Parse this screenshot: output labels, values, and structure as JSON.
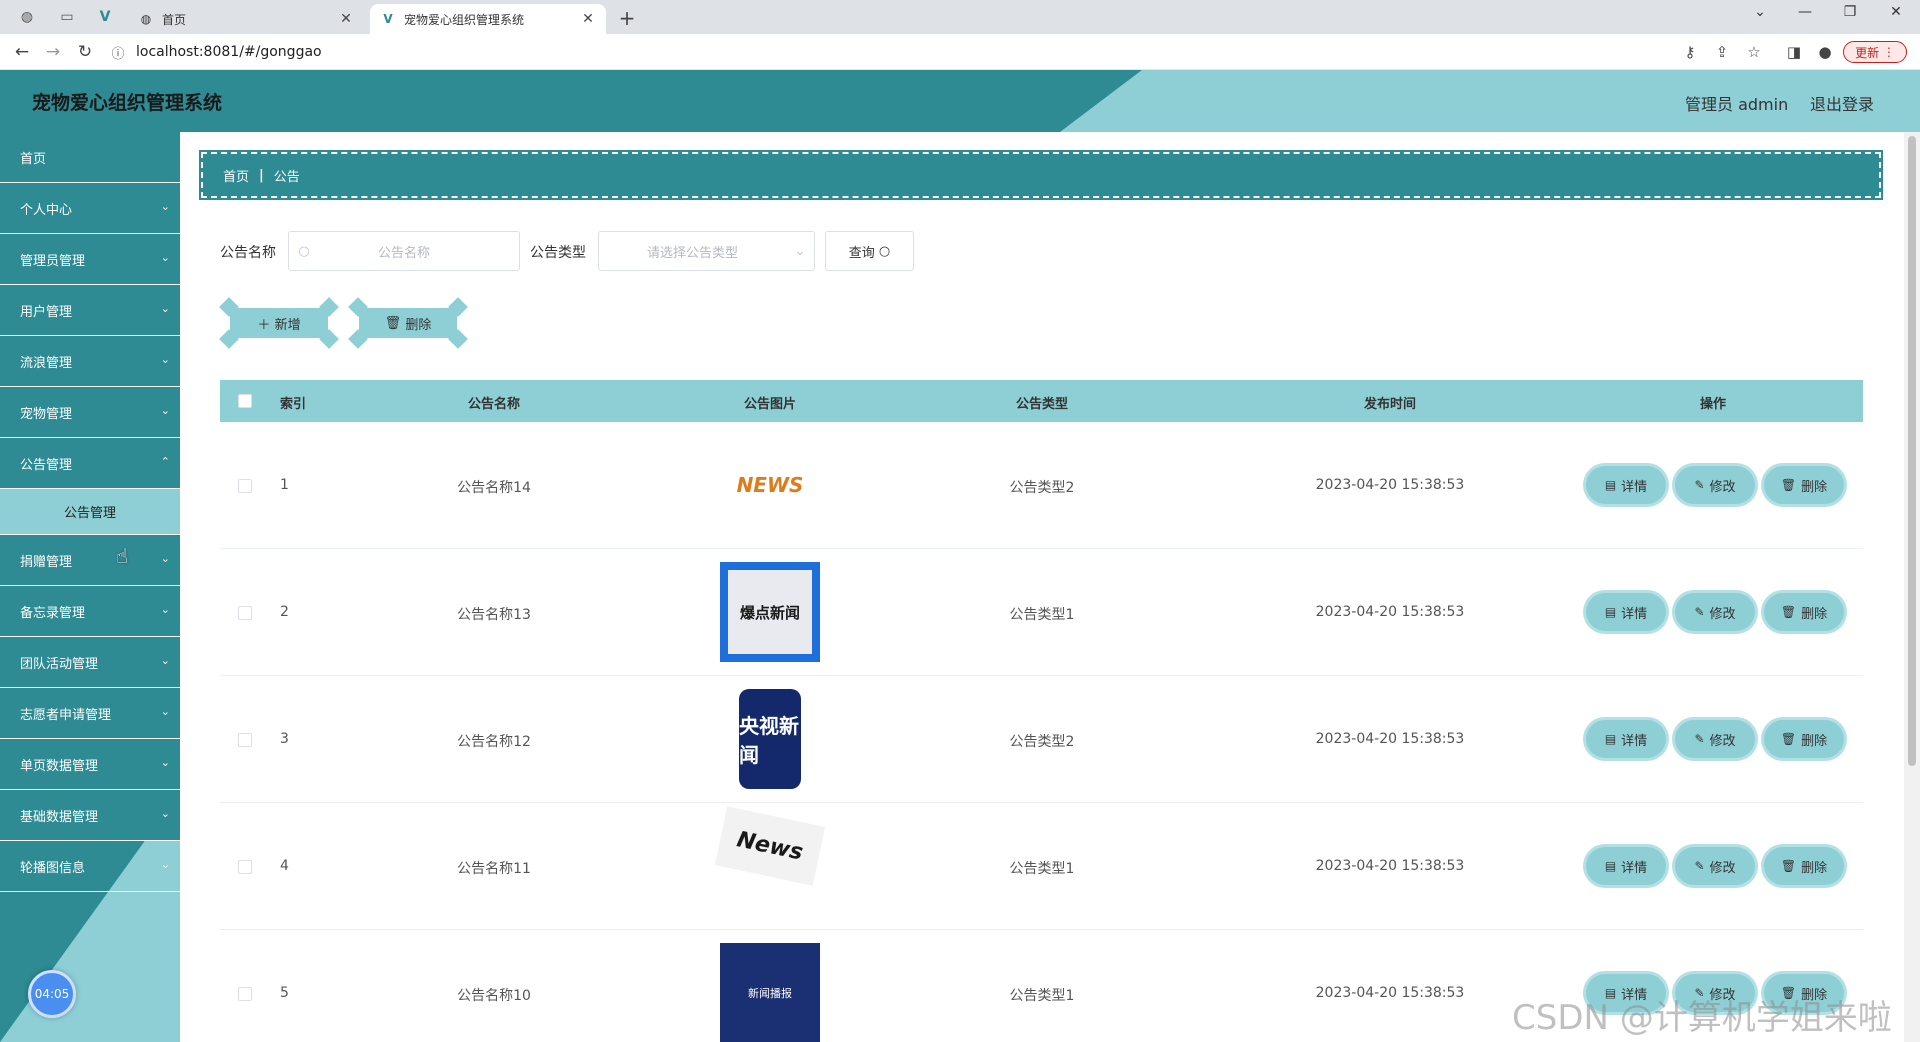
{
  "browser": {
    "tabs": [
      {
        "title": "首页",
        "active": false
      },
      {
        "title": "宠物爱心组织管理系统",
        "active": true
      }
    ],
    "new_tab": "+",
    "url": "localhost:8081/#/gonggao",
    "update_label": "更新"
  },
  "header": {
    "title": "宠物爱心组织管理系统",
    "user": "管理员 admin",
    "logout": "退出登录"
  },
  "sidebar": {
    "items": [
      {
        "label": "首页",
        "chevron": false
      },
      {
        "label": "个人中心",
        "chevron": true
      },
      {
        "label": "管理员管理",
        "chevron": true
      },
      {
        "label": "用户管理",
        "chevron": true
      },
      {
        "label": "流浪管理",
        "chevron": true
      },
      {
        "label": "宠物管理",
        "chevron": true
      },
      {
        "label": "公告管理",
        "chevron": true
      },
      {
        "label": "捐赠管理",
        "chevron": true
      },
      {
        "label": "备忘录管理",
        "chevron": true
      },
      {
        "label": "团队活动管理",
        "chevron": true
      },
      {
        "label": "志愿者申请管理",
        "chevron": true
      },
      {
        "label": "单页数据管理",
        "chevron": true
      },
      {
        "label": "基础数据管理",
        "chevron": true
      },
      {
        "label": "轮播图信息",
        "chevron": true
      }
    ],
    "subitem": "公告管理",
    "clock": "04:05"
  },
  "breadcrumb": {
    "home": "首页",
    "sep": "|",
    "current": "公告"
  },
  "filters": {
    "name_label": "公告名称",
    "name_placeholder": "公告名称",
    "type_label": "公告类型",
    "type_placeholder": "请选择公告类型",
    "query_label": "查询"
  },
  "actions": {
    "add": "新增",
    "delete": "删除"
  },
  "table": {
    "columns": [
      "索引",
      "公告名称",
      "公告图片",
      "公告类型",
      "发布时间",
      "操作"
    ],
    "rows": [
      {
        "index": "1",
        "name": "公告名称14",
        "image": "NEWS",
        "type": "公告类型2",
        "time": "2023-04-20 15:38:53"
      },
      {
        "index": "2",
        "name": "公告名称13",
        "image": "爆点新闻",
        "type": "公告类型1",
        "time": "2023-04-20 15:38:53"
      },
      {
        "index": "3",
        "name": "公告名称12",
        "image": "央视新闻",
        "type": "公告类型2",
        "time": "2023-04-20 15:38:53"
      },
      {
        "index": "4",
        "name": "公告名称11",
        "image": "News",
        "type": "公告类型1",
        "time": "2023-04-20 15:38:53"
      },
      {
        "index": "5",
        "name": "公告名称10",
        "image": "新闻播报",
        "type": "公告类型1",
        "time": "2023-04-20 15:38:53"
      }
    ],
    "row_actions": {
      "detail": "详情",
      "edit": "修改",
      "delete": "删除"
    }
  },
  "watermark": "CSDN @计算机学姐来啦",
  "colors": {
    "primary": "#2e8a93",
    "accent": "#8ecfd6"
  }
}
